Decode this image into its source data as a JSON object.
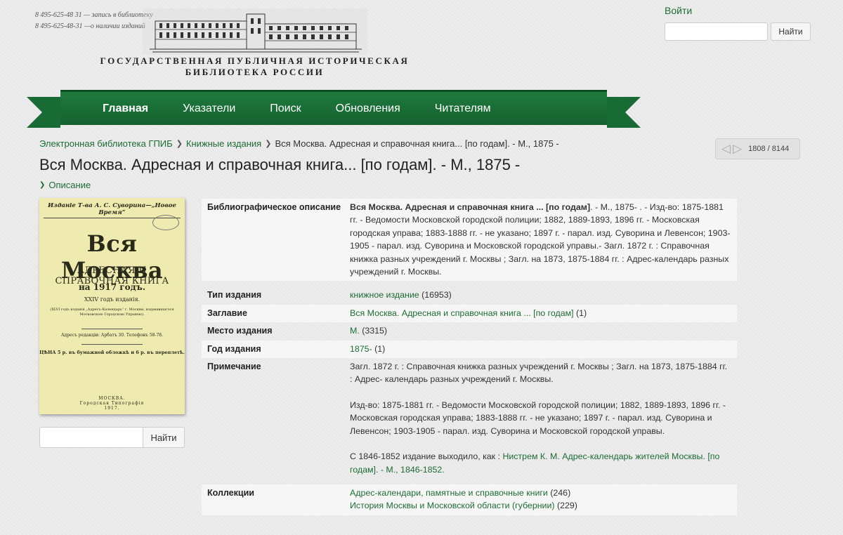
{
  "header": {
    "phones": [
      {
        "number": "8 495-625-48 31",
        "note": " — запись в библиотеку"
      },
      {
        "number": "8 495-625-48-31",
        "note": " —о наличии изданий"
      }
    ],
    "logo_line1": "ГОСУДАРСТВЕННАЯ ПУБЛИЧНАЯ ИСТОРИЧЕСКАЯ",
    "logo_line2": "БИБЛИОТЕКА РОССИИ",
    "login": "Войти",
    "search_button": "Найти",
    "search_placeholder": ""
  },
  "nav": {
    "items": [
      {
        "label": "Главная"
      },
      {
        "label": "Указатели"
      },
      {
        "label": "Поиск"
      },
      {
        "label": "Обновления"
      },
      {
        "label": "Читателям"
      }
    ],
    "active": "Главная"
  },
  "breadcrumb": [
    "Электронная библиотека ГПИБ",
    "Книжные издания",
    "Вся Москва. Адресная и справочная книга... [по годам]. - М., 1875 -"
  ],
  "pager": {
    "text": "1808 / 8144"
  },
  "page_title": "Вся Москва. Адресная и справочная книга... [по годам]. - М., 1875 -",
  "description_toggle": "Описание",
  "cover": {
    "top": "Изданіе Т-ва А. С. Суворина—„Новое Время“",
    "title": "Вся Москва",
    "subtitle": "АДРЕСНАЯ И СПРАВОЧНАЯ КНИГА",
    "year": "на 1917 годъ.",
    "edition": "XXIV годъ изданія.",
    "note": "(XLVI годъ изданія „Адресъ-Календарь“ г. Москвы, издававшагося Московскою Городскою Управою).",
    "address": "Адресъ редакціи: Арбатъ 30. Телефонъ 58-78.",
    "price": "ЦѢНА 5 р. въ бумажной обложкѣ и 6 р. въ переплетѣ.",
    "city": "МОСКВА.",
    "printer": "Городская Типографія",
    "print_year": "1917."
  },
  "side_search": {
    "button": "Найти",
    "placeholder": ""
  },
  "record": {
    "bib": {
      "label": "Библиографическое описание",
      "title": "Вся Москва. Адресная и справочная книга ... [по годам]",
      "rest": ". - М., 1875- . - Изд-во: 1875-1881 гг. - Ведомости Московской городской полиции; 1882, 1889-1893, 1896 гг. - Московская городская управа; 1883-1888 гг. - не указано; 1897 г. - парал. изд. Суворина и Левенсон; 1903-1905 - парал. изд. Суворина и Московской городской управы.- Загл. 1872 г. : Справочная книжка разных учреждений г. Москвы ; Загл. на 1873, 1875-1884 гг. : Адрес-календарь разных учреждений г. Москвы."
    },
    "type": {
      "label": "Тип издания",
      "link": "книжное издание",
      "count": " (16953)"
    },
    "title": {
      "label": "Заглавие",
      "link": "Вся Москва. Адресная и справочная книга ... [по годам]",
      "count": " (1)"
    },
    "place": {
      "label": "Место издания",
      "link": "М.",
      "count": " (3315)"
    },
    "year": {
      "label": "Год издания",
      "link": "1875-",
      "count": " (1)"
    },
    "notes": {
      "label": "Примечание",
      "p1": "Загл. 1872 г. : Справочная книжка разных учреждений г. Москвы ; Загл. на 1873, 1875-1884 гг. : Адрес- календарь разных учреждений г. Москвы.",
      "p2": "Изд-во: 1875-1881 гг. - Ведомости Московской городской полиции; 1882, 1889-1893, 1896 гг. - Московская городская управа; 1883-1888 гг. - не указано; 1897 г. - парал. изд. Суворина и Левенсон; 1903-1905 - парал. изд. Суворина и Московской городской управы.",
      "p3_text": "С 1846-1852 издание выходило, как : ",
      "p3_link": "Нистрем К. М. Адрес-календарь жителей Москвы. [по годам]. - М., 1846-1852."
    },
    "collections": {
      "label": "Коллекции",
      "items": [
        {
          "link": "Адрес-календари, памятные и справочные книги",
          "count": " (246)"
        },
        {
          "link": "История Москвы и Московской области (губернии)",
          "count": " (229)"
        }
      ]
    }
  },
  "colors": {
    "brand_green": "#186b34",
    "link": "#1e6b34"
  }
}
